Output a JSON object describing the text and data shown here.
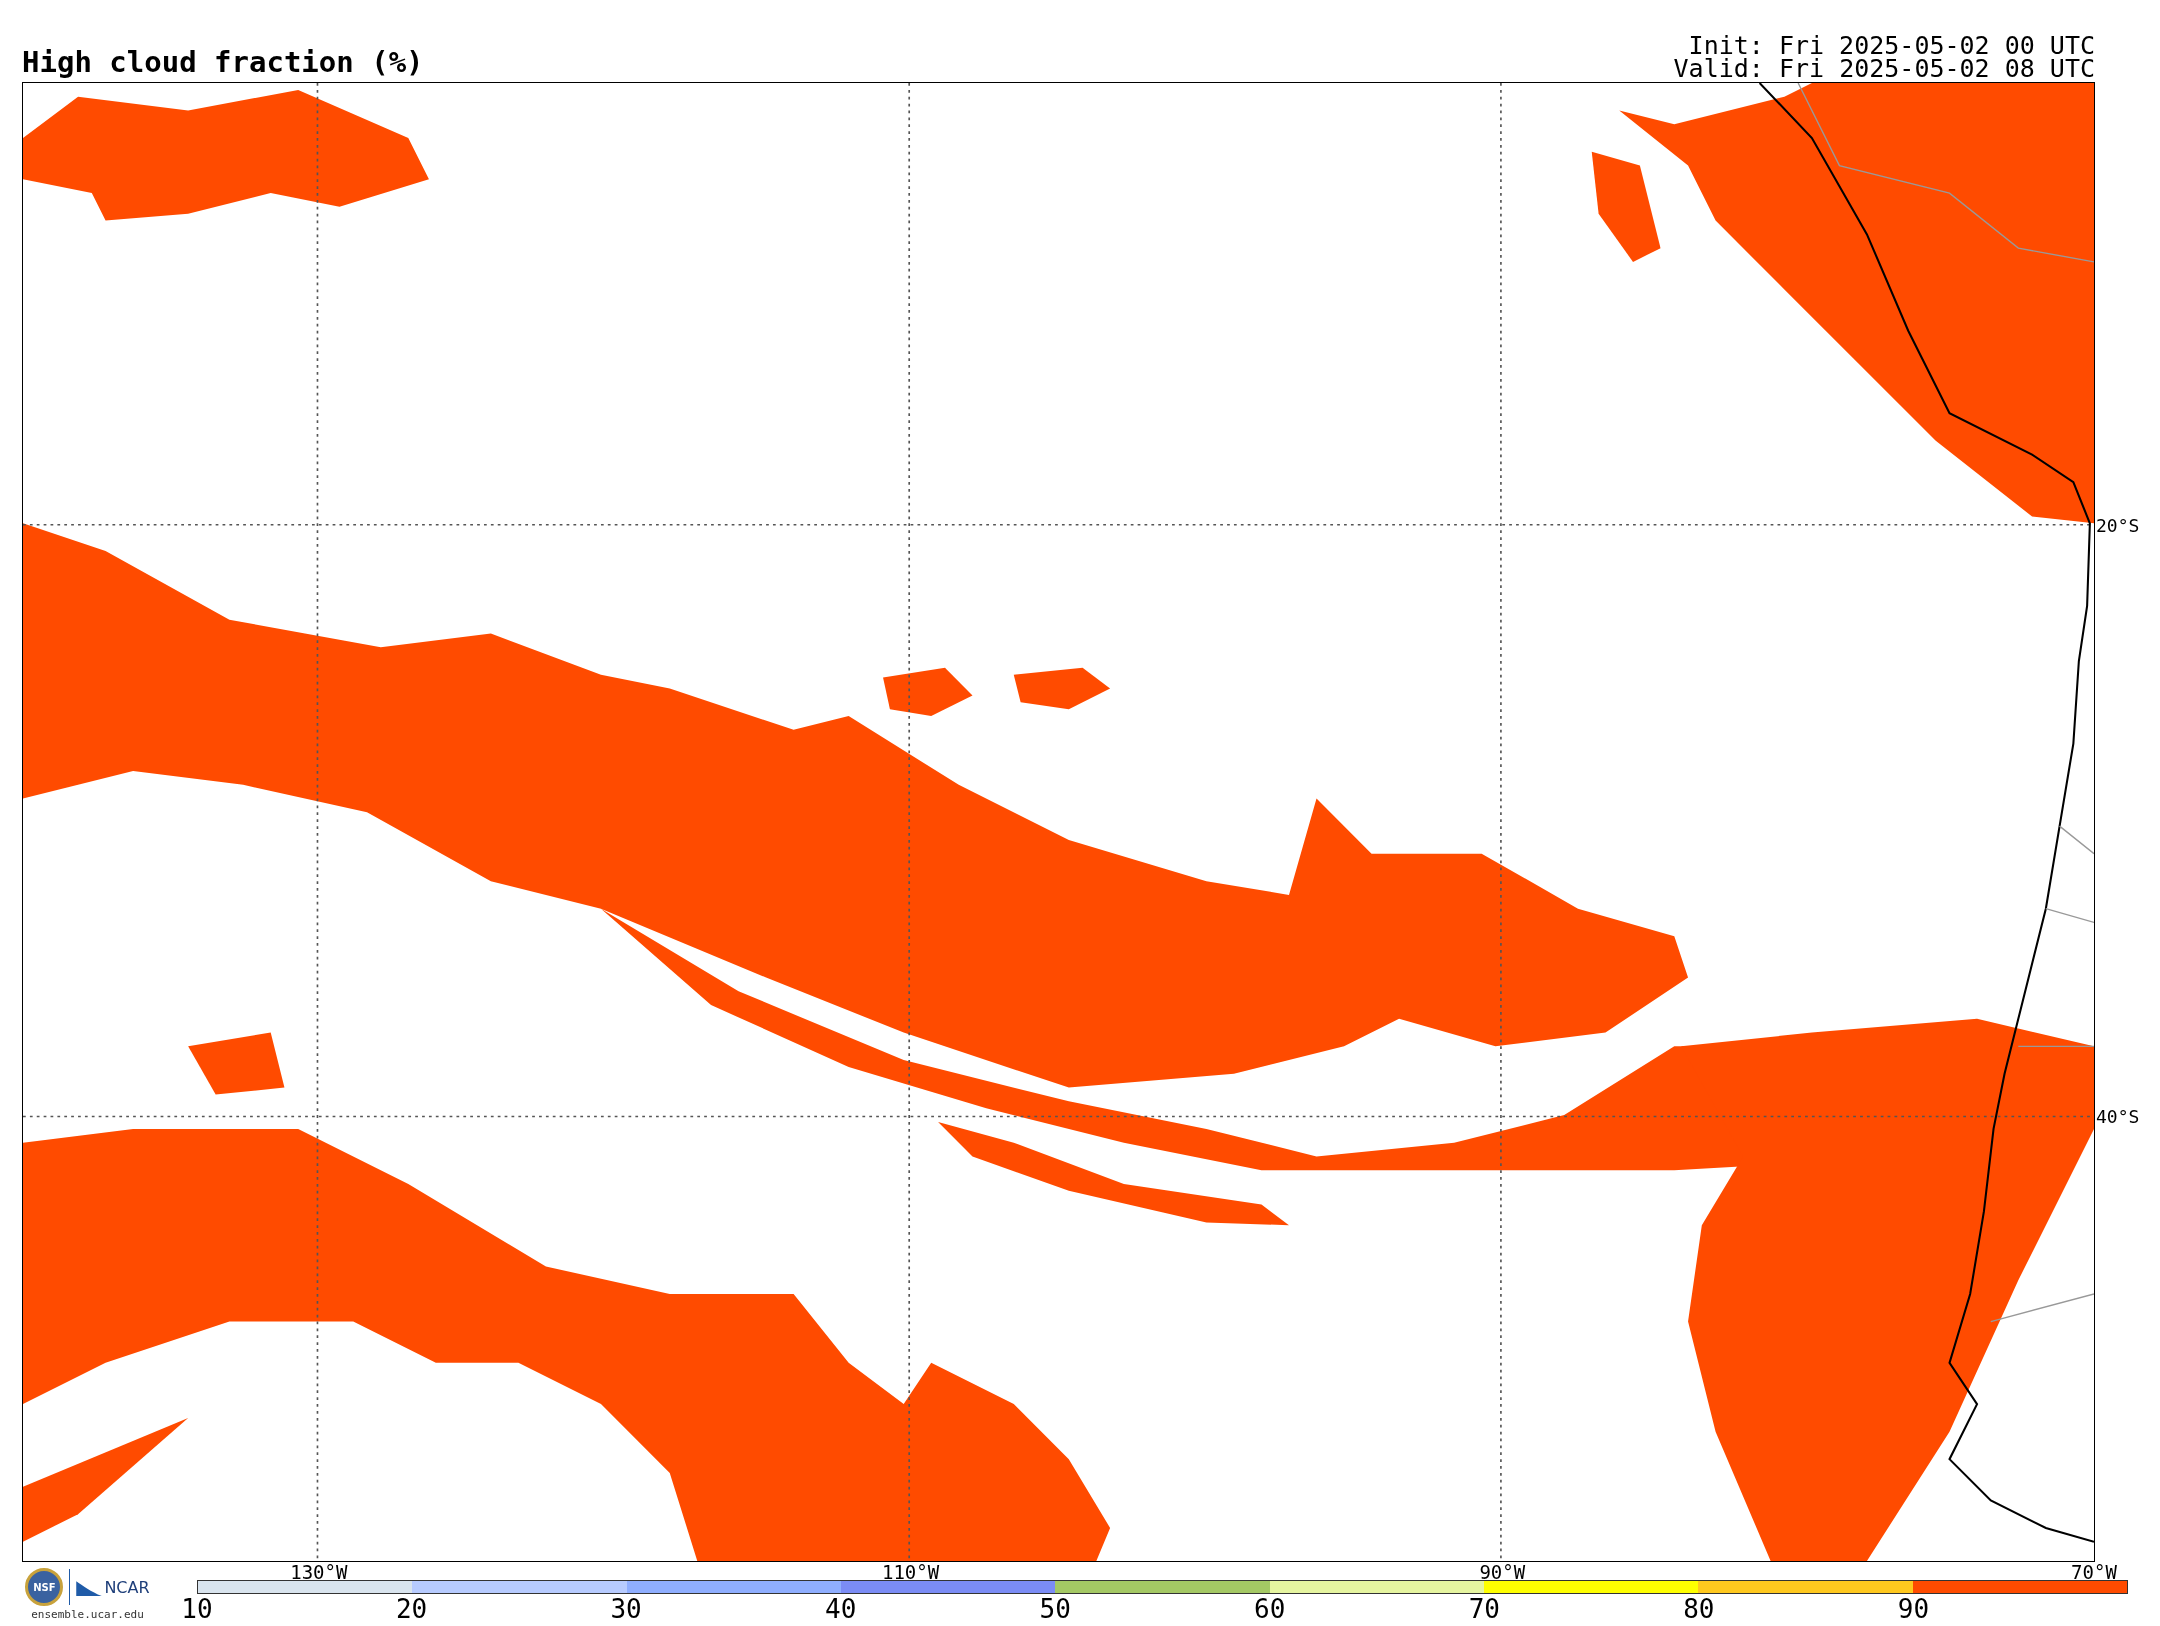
{
  "title": "High cloud fraction (%)",
  "init": "Init: Fri 2025-05-02 00 UTC",
  "valid": "Valid: Fri 2025-05-02 08 UTC",
  "map": {
    "lat_labels": [
      "20°S",
      "40°S"
    ],
    "lon_labels": [
      "130°W",
      "110°W",
      "90°W",
      "70°W"
    ]
  },
  "logos": {
    "nsf": "NSF",
    "ncar": "NCAR",
    "site": "ensemble.ucar.edu"
  },
  "colorbar": {
    "segments": [
      {
        "color": "#d9e4ee"
      },
      {
        "color": "#b7cbff"
      },
      {
        "color": "#8faeff"
      },
      {
        "color": "#7b8cf5"
      },
      {
        "color": "#a4c864"
      },
      {
        "color": "#e6f5a0"
      },
      {
        "color": "#ffff00"
      },
      {
        "color": "#ffc81e"
      },
      {
        "color": "#ff4b00"
      }
    ],
    "ticks": [
      "10",
      "20",
      "30",
      "40",
      "50",
      "60",
      "70",
      "80",
      "90"
    ]
  }
}
